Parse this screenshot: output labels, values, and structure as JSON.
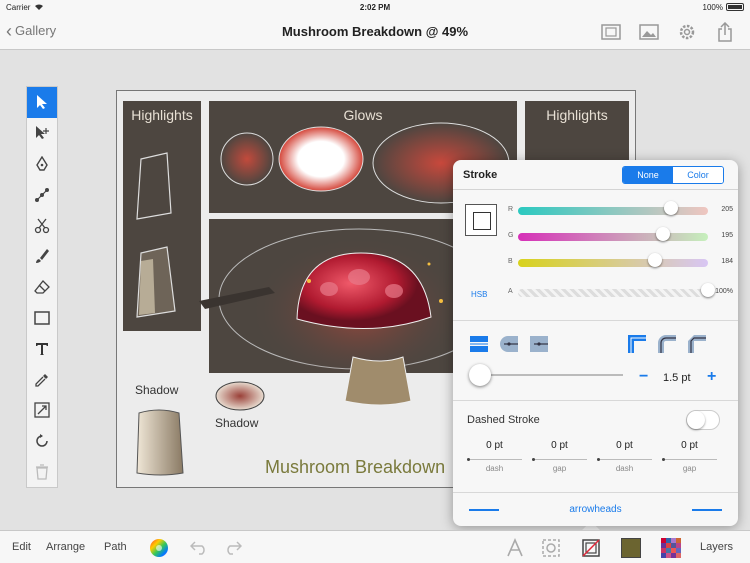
{
  "status_bar": {
    "carrier": "Carrier",
    "time": "2:02 PM",
    "battery": "100%"
  },
  "nav": {
    "back_label": "Gallery",
    "title": "Mushroom Breakdown @ 49%"
  },
  "canvas": {
    "panels": {
      "highlights_left": "Highlights",
      "glows": "Glows",
      "highlights_right": "Highlights",
      "shadow_left": "Shadow",
      "shadow_mid": "Shadow",
      "caption": "Mushroom Breakdown"
    }
  },
  "stroke": {
    "title": "Stroke",
    "mode_none": "None",
    "mode_color": "Color",
    "color_model": "HSB",
    "channels": [
      {
        "label": "R",
        "value": "205",
        "fraction": 0.804,
        "gradient": "linear-gradient(90deg,#2bc9c0,#f0c6c0)"
      },
      {
        "label": "G",
        "value": "195",
        "fraction": 0.765,
        "gradient": "linear-gradient(90deg,#d62fb8,#c6f0bc)"
      },
      {
        "label": "B",
        "value": "184",
        "fraction": 0.722,
        "gradient": "linear-gradient(90deg,#d8d21c,#d8c6f4)"
      },
      {
        "label": "A",
        "value": "100%",
        "fraction": 1.0,
        "gradient": "repeating-linear-gradient(45deg,#ddd 0 3px,#f4f4f4 3px 6px)"
      }
    ],
    "width_value": "1.5 pt",
    "width_fraction": 0.04,
    "minus_label": "−",
    "plus_label": "+",
    "dashed_label": "Dashed Stroke",
    "dash_cells": [
      {
        "value": "0 pt",
        "key": "dash"
      },
      {
        "value": "0 pt",
        "key": "gap"
      },
      {
        "value": "0 pt",
        "key": "dash"
      },
      {
        "value": "0 pt",
        "key": "gap"
      }
    ],
    "arrowheads_label": "arrowheads"
  },
  "bottom_bar": {
    "edit": "Edit",
    "arrange": "Arrange",
    "path": "Path",
    "layers": "Layers"
  },
  "colors": {
    "accent": "#1a7bea",
    "panel": "#4d4640",
    "fill_swatch": "#6b6430"
  }
}
